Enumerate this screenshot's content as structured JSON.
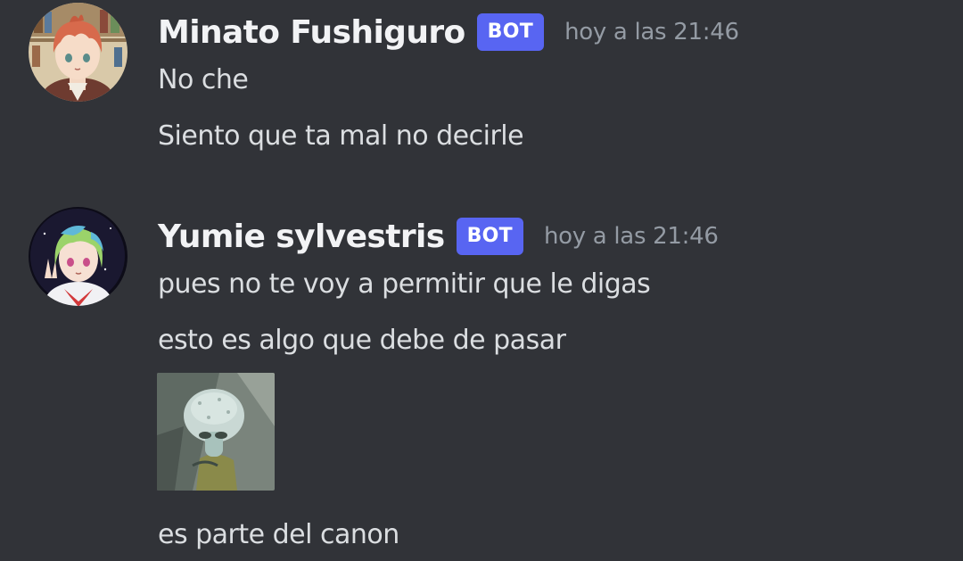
{
  "messages": [
    {
      "author": "Minato Fushiguro",
      "badge": "BOT",
      "timestamp": "hoy a las 21:46",
      "lines": [
        "No che",
        "Siento que ta mal no decirle"
      ]
    },
    {
      "author": "Yumie sylvestris",
      "badge": "BOT",
      "timestamp": "hoy a las 21:46",
      "lines": [
        "pues no te voy a permitir que le digas",
        "esto es algo que debe de pasar",
        "es parte del canon"
      ]
    }
  ],
  "colors": {
    "background": "#313338",
    "username": "#f2f3f5",
    "bot_badge": "#5865f2",
    "timestamp": "#949ba4",
    "message_text": "#dbdee1"
  }
}
